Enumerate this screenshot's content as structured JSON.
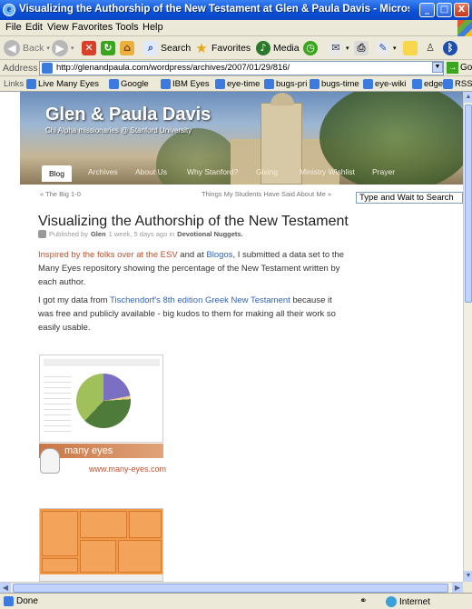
{
  "window": {
    "title": "Visualizing the Authorship of the New Testament at Glen & Paula Davis - Microsoft Internet Explorer",
    "controls": {
      "minimize": "_",
      "maximize": "□",
      "close": "X"
    }
  },
  "menu": [
    "File",
    "Edit",
    "View",
    "Favorites",
    "Tools",
    "Help"
  ],
  "toolbar": {
    "back": "Back",
    "search": "Search",
    "favorites": "Favorites",
    "media": "Media"
  },
  "address": {
    "label": "Address",
    "url": "http://glenandpaula.com/wordpress/archives/2007/01/29/816/",
    "go": "Go"
  },
  "links": {
    "label": "Links",
    "items": [
      "Live Many Eyes",
      "Google",
      "IBM Eyes",
      "eye-time",
      "bugs-pri",
      "bugs-time",
      "eye-wiki",
      "edge",
      "RSS"
    ]
  },
  "site": {
    "title": "Glen & Paula Davis",
    "tagline": "Chi Alpha missionaries @ Stanford University",
    "nav": [
      "Blog",
      "Archives",
      "About Us",
      "Why Stanford?",
      "Giving",
      "Ministry Wishlist",
      "Prayer"
    ],
    "prev": "« The Big 1-0",
    "next": "Things My Students Have Said About Me »",
    "search_placeholder": "Type and Wait to Search"
  },
  "post": {
    "title": "Visualizing the Authorship of the New Testament",
    "meta_prefix": "Published by",
    "author": "Glen",
    "meta_mid": "1 week, 5 days ago in",
    "category": "Devotional Nuggets.",
    "p1_link1": "Inspired by the folks over at the ESV",
    "p1_text1": " and at ",
    "p1_link2": "Blogos",
    "p1_text2": ", I submitted a data set to the Many Eyes repository showing the percentage of the New Testament written by each author.",
    "p2_text1": "I got my data from ",
    "p2_link": "Tischendorf's 8th edition Greek New Testament",
    "p2_text2": " because it was free and publicly available - big kudos to them for making all their work so easily usable.",
    "many_eyes_label": "many eyes",
    "many_eyes_url": "www.many-eyes.com"
  },
  "status": {
    "text": "Done",
    "zone": "Internet"
  }
}
